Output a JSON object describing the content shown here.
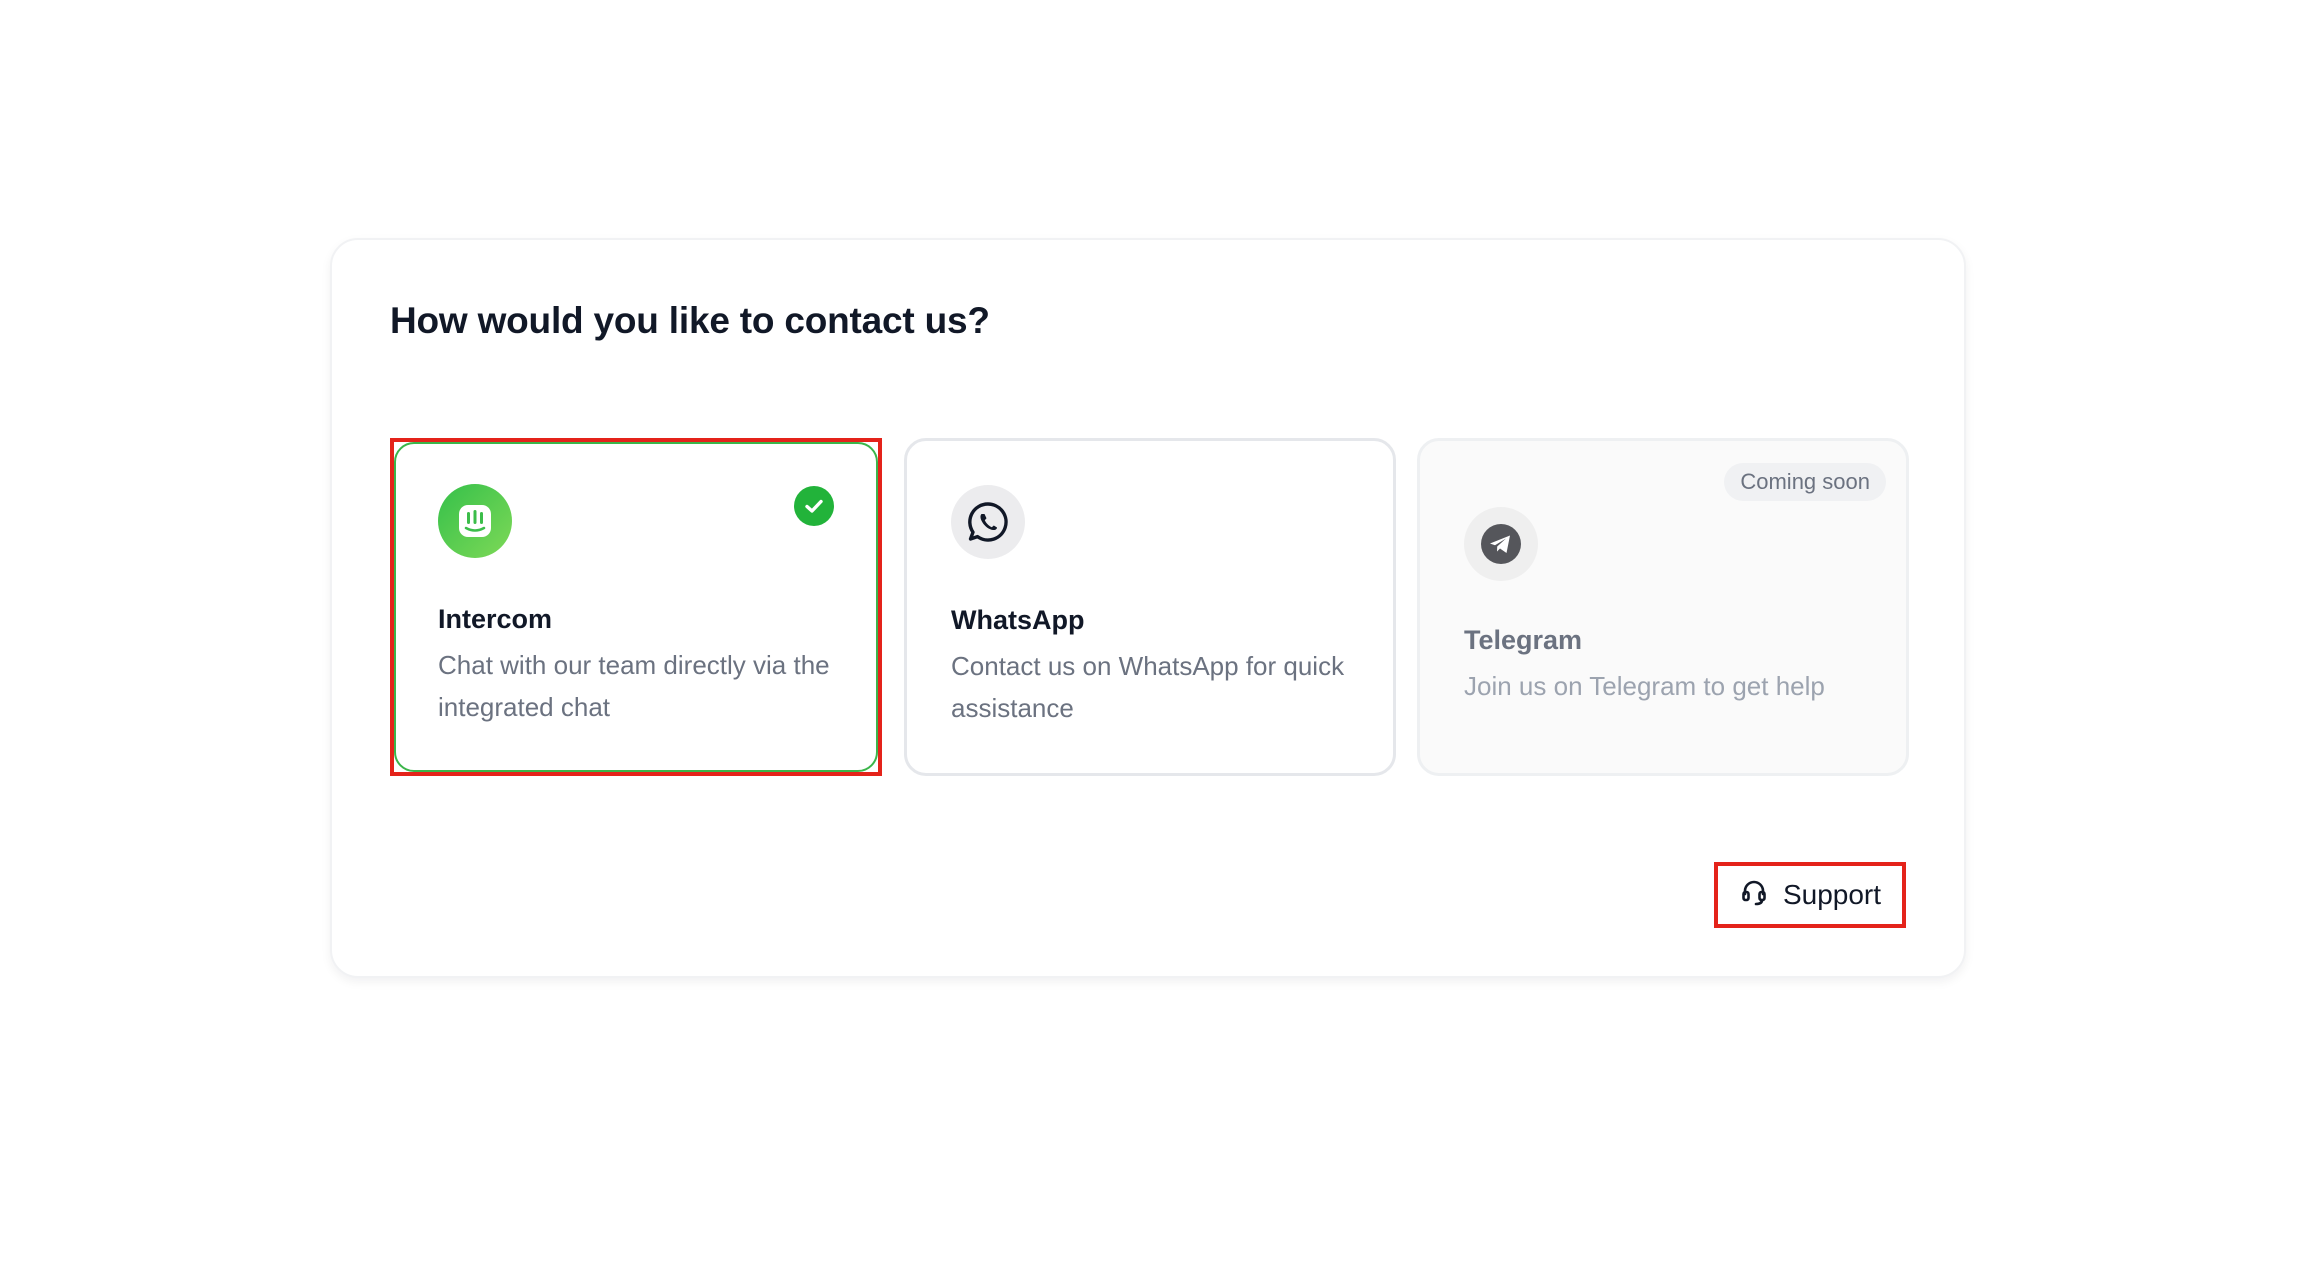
{
  "heading": "How would you like to contact us?",
  "options": [
    {
      "id": "intercom",
      "title": "Intercom",
      "description": "Chat with our team directly via the integrated chat",
      "icon": "intercom-icon",
      "selected": true
    },
    {
      "id": "whatsapp",
      "title": "WhatsApp",
      "description": "Contact us on WhatsApp for quick assistance",
      "icon": "whatsapp-icon",
      "selected": false
    },
    {
      "id": "telegram",
      "title": "Telegram",
      "description": "Join us on Telegram to get help",
      "icon": "telegram-icon",
      "selected": false,
      "badge": "Coming soon"
    }
  ],
  "support": {
    "label": "Support",
    "icon": "headset-icon"
  },
  "colors": {
    "accent_green": "#22b33a",
    "highlight_red": "#e4231a",
    "heading_text": "#111827",
    "muted_text": "#6b7280"
  }
}
